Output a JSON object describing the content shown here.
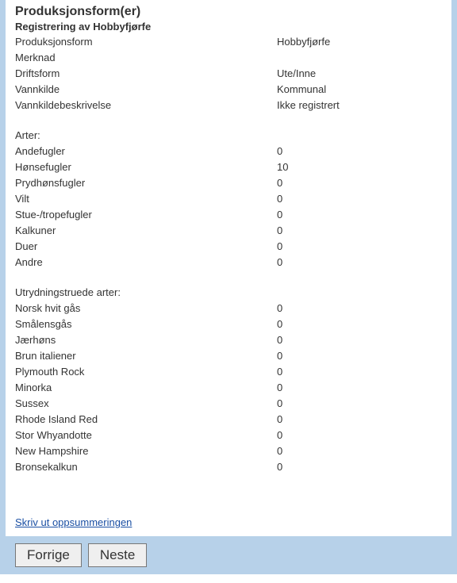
{
  "title": "Produksjonsform(er)",
  "subtitle": "Registrering av Hobbyfjørfe",
  "summary_rows": [
    {
      "label": "Produksjonsform",
      "value": "Hobbyfjørfe"
    },
    {
      "label": "Merknad",
      "value": ""
    },
    {
      "label": "Driftsform",
      "value": "Ute/Inne"
    },
    {
      "label": "Vannkilde",
      "value": "Kommunal"
    },
    {
      "label": "Vannkildebeskrivelse",
      "value": "Ikke registrert"
    }
  ],
  "arter_heading": "Arter:",
  "arter_rows": [
    {
      "label": "Andefugler",
      "value": "0"
    },
    {
      "label": "Hønsefugler",
      "value": "10"
    },
    {
      "label": "Prydhønsfugler",
      "value": "0"
    },
    {
      "label": "Vilt",
      "value": "0"
    },
    {
      "label": "Stue-/tropefugler",
      "value": "0"
    },
    {
      "label": "Kalkuner",
      "value": "0"
    },
    {
      "label": "Duer",
      "value": "0"
    },
    {
      "label": "Andre",
      "value": "0"
    }
  ],
  "utryd_heading": "Utrydningstruede arter:",
  "utryd_rows": [
    {
      "label": "Norsk hvit gås",
      "value": "0"
    },
    {
      "label": "Smålensgås",
      "value": "0"
    },
    {
      "label": "Jærhøns",
      "value": "0"
    },
    {
      "label": "Brun italiener",
      "value": "0"
    },
    {
      "label": "Plymouth Rock",
      "value": "0"
    },
    {
      "label": "Minorka",
      "value": "0"
    },
    {
      "label": "Sussex",
      "value": "0"
    },
    {
      "label": "Rhode Island Red",
      "value": "0"
    },
    {
      "label": "Stor Whyandotte",
      "value": "0"
    },
    {
      "label": "New Hampshire",
      "value": "0"
    },
    {
      "label": "Bronsekalkun",
      "value": "0"
    }
  ],
  "print_link_label": "Skriv ut oppsummeringen",
  "footer": {
    "prev_label": "Forrige",
    "next_label": "Neste"
  }
}
